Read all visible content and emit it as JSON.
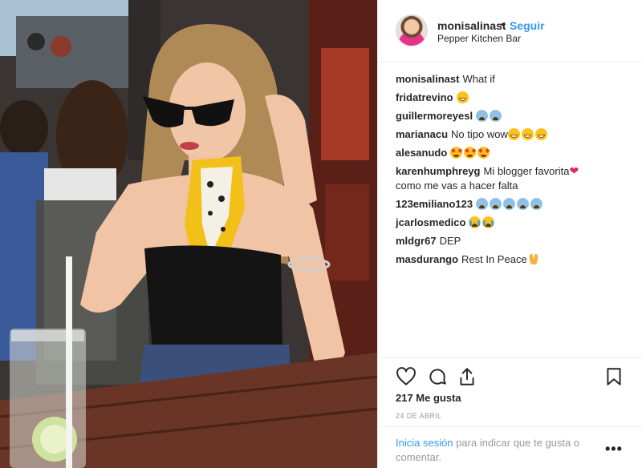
{
  "post": {
    "username": "monisalinast",
    "separator": "•",
    "follow_label": "Seguir",
    "location": "Pepper Kitchen Bar"
  },
  "comments": [
    {
      "user": "monisalinast",
      "text": "What if",
      "emoji": []
    },
    {
      "user": "fridatrevino",
      "text": "",
      "emoji": [
        "grin"
      ]
    },
    {
      "user": "guillermoreyesl",
      "text": "",
      "emoji": [
        "sweat",
        "sweat"
      ]
    },
    {
      "user": "marianacu",
      "text": "No tipo wow",
      "emoji": [
        "grin",
        "grin",
        "grin"
      ]
    },
    {
      "user": "alesanudo",
      "text": "",
      "emoji": [
        "star",
        "star",
        "star"
      ]
    },
    {
      "user": "karenhumphreyg",
      "text": "Mi blogger favorita",
      "emoji": [
        "heart"
      ],
      "text2": "como me vas a hacer falta"
    },
    {
      "user": "123emiliano123",
      "text": "",
      "emoji": [
        "sweat",
        "sweat",
        "sweat",
        "sweat",
        "sweat"
      ]
    },
    {
      "user": "jcarlosmedico",
      "text": "",
      "emoji": [
        "cry",
        "cry"
      ]
    },
    {
      "user": "mldgr67",
      "text": "DEP",
      "emoji": []
    },
    {
      "user": "masdurango",
      "text": "Rest In Peace",
      "emoji": [
        "pray"
      ]
    }
  ],
  "actions": {
    "like_icon": "heart-outline-icon",
    "comment_icon": "speech-bubble-icon",
    "share_icon": "share-icon",
    "save_icon": "bookmark-icon"
  },
  "likes_label": "217 Me gusta",
  "date_label": "24 DE ABRIL",
  "footer": {
    "login_link": "Inicia sesión",
    "prompt": " para indicar que te gusta o comentar.",
    "more_label": "•••"
  },
  "colors": {
    "link_blue": "#3897f0",
    "text_dark": "#262626",
    "muted": "#999999",
    "divider": "#efefef"
  }
}
